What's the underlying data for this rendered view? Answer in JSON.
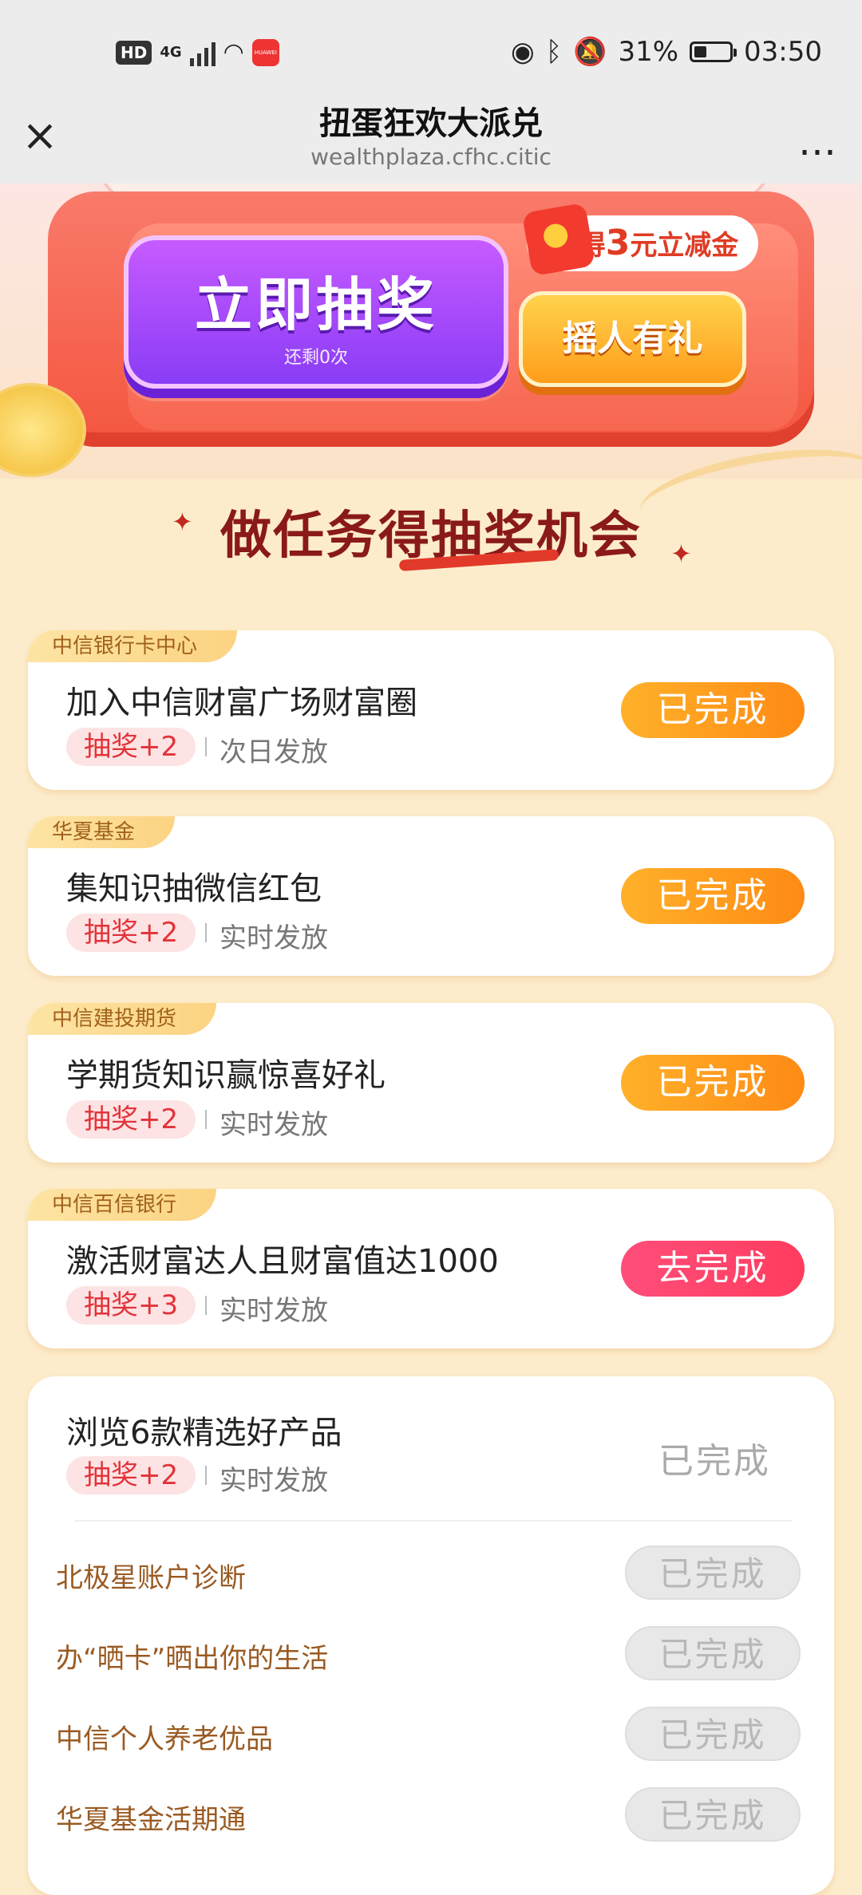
{
  "status_bar": {
    "network": "4G",
    "battery": "31%",
    "time": "03:50",
    "battery_level": 0.31
  },
  "nav": {
    "title": "扭蛋狂欢大派兑",
    "url": "wealthplaza.cfhc.citic",
    "more": "…"
  },
  "hero": {
    "draw_button": "立即抽奖",
    "draw_remaining": "还剩0次",
    "bubble_prefix": "得",
    "bubble_number": "3",
    "bubble_suffix": "元立减金",
    "shake_button": "摇人有礼"
  },
  "section_title": "做任务得抽奖机会",
  "tasks": [
    {
      "tag": "中信银行卡中心",
      "title": "加入中信财富广场财富圈",
      "reward": "抽奖+2",
      "delivery": "次日发放",
      "action": "已完成"
    },
    {
      "tag": "华夏基金",
      "title": "集知识抽微信红包",
      "reward": "抽奖+2",
      "delivery": "实时发放",
      "action": "已完成"
    },
    {
      "tag": "中信建投期货",
      "title": "学期货知识赢惊喜好礼",
      "reward": "抽奖+2",
      "delivery": "实时发放",
      "action": "已完成"
    },
    {
      "tag": "中信百信银行",
      "title": "激活财富达人且财富值达1000",
      "reward": "抽奖+3",
      "delivery": "实时发放",
      "action": "去完成"
    }
  ],
  "browse_task": {
    "title": "浏览6款精选好产品",
    "reward": "抽奖+2",
    "delivery": "实时发放",
    "status": "已完成",
    "items": [
      {
        "label": "北极星账户诊断",
        "action": "已完成"
      },
      {
        "label": "办“晒卡”晒出你的生活",
        "action": "已完成"
      },
      {
        "label": "中信个人养老优品",
        "action": "已完成"
      },
      {
        "label": "华夏基金活期通",
        "action": "已完成"
      }
    ]
  }
}
